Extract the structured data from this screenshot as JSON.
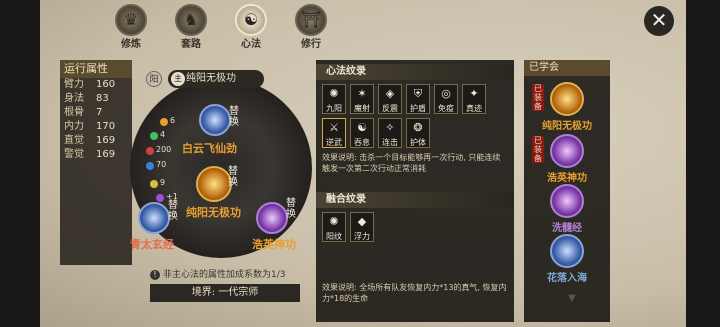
{
  "tabs": [
    {
      "label": "修炼",
      "icon": "cultivation-icon"
    },
    {
      "label": "套路",
      "icon": "routine-icon"
    },
    {
      "label": "心法",
      "icon": "mental-method-icon"
    },
    {
      "label": "修行",
      "icon": "practice-icon"
    }
  ],
  "active_tab": "心法",
  "attributes": {
    "title": "运行属性",
    "rows": [
      {
        "k": "臂力",
        "v": "160"
      },
      {
        "k": "身法",
        "v": "83"
      },
      {
        "k": "根骨",
        "v": "7"
      },
      {
        "k": "内力",
        "v": "170"
      },
      {
        "k": "直觉",
        "v": "169"
      },
      {
        "k": "警觉",
        "v": "169"
      }
    ]
  },
  "circle": {
    "yang": "阳",
    "main_icon": "主",
    "main_chip": "纯阳无极功",
    "swap": "替换",
    "nodes": {
      "top": "白云飞仙劲",
      "center": "纯阳无极功",
      "left": "青太玄经",
      "right": "浩英神功"
    },
    "stats": [
      "6",
      "4",
      "200",
      "70",
      "9",
      "+1"
    ]
  },
  "note": "非主心法的属性加成系数为1/3",
  "note_icon": "!",
  "realm": "境界: 一代宗师",
  "mind_pattern": {
    "title": "心法纹录",
    "cells": [
      {
        "n": "九阳",
        "g": "✺",
        "lit": false
      },
      {
        "n": "魔射",
        "g": "✶",
        "lit": false
      },
      {
        "n": "反震",
        "g": "◈",
        "lit": false
      },
      {
        "n": "护盾",
        "g": "⛨",
        "lit": false
      },
      {
        "n": "免疫",
        "g": "◎",
        "lit": false
      },
      {
        "n": "真迹",
        "g": "✦",
        "lit": false
      },
      {
        "n": "逆武",
        "g": "⚔",
        "lit": true
      },
      {
        "n": "吞息",
        "g": "☯",
        "lit": false
      },
      {
        "n": "连击",
        "g": "✧",
        "lit": false
      },
      {
        "n": "护体",
        "g": "❂",
        "lit": false
      }
    ],
    "desc": "效果说明: 击杀一个目标能够再一次行动, 只能连续触发一次第二次行动正常消耗"
  },
  "fusion_pattern": {
    "title": "融合纹录",
    "cells": [
      {
        "n": "阳纹",
        "g": "✺",
        "lit": false
      },
      {
        "n": "浮力",
        "g": "◆",
        "lit": false
      }
    ],
    "desc": "效果说明: 全场所有队友恢复内力*13的真气, 恢复内力*18的生命"
  },
  "learned": {
    "title": "已学会",
    "tag": "已装备",
    "skills": [
      {
        "name": "纯阳无极功",
        "color": "gold",
        "equipped": true
      },
      {
        "name": "浩英神功",
        "color": "purple",
        "equipped": true
      },
      {
        "name": "洗髓经",
        "color": "purple",
        "equipped": false
      },
      {
        "name": "花落入海",
        "color": "blue",
        "equipped": false
      }
    ]
  },
  "close_label": "✕",
  "scroll_down": "▼"
}
